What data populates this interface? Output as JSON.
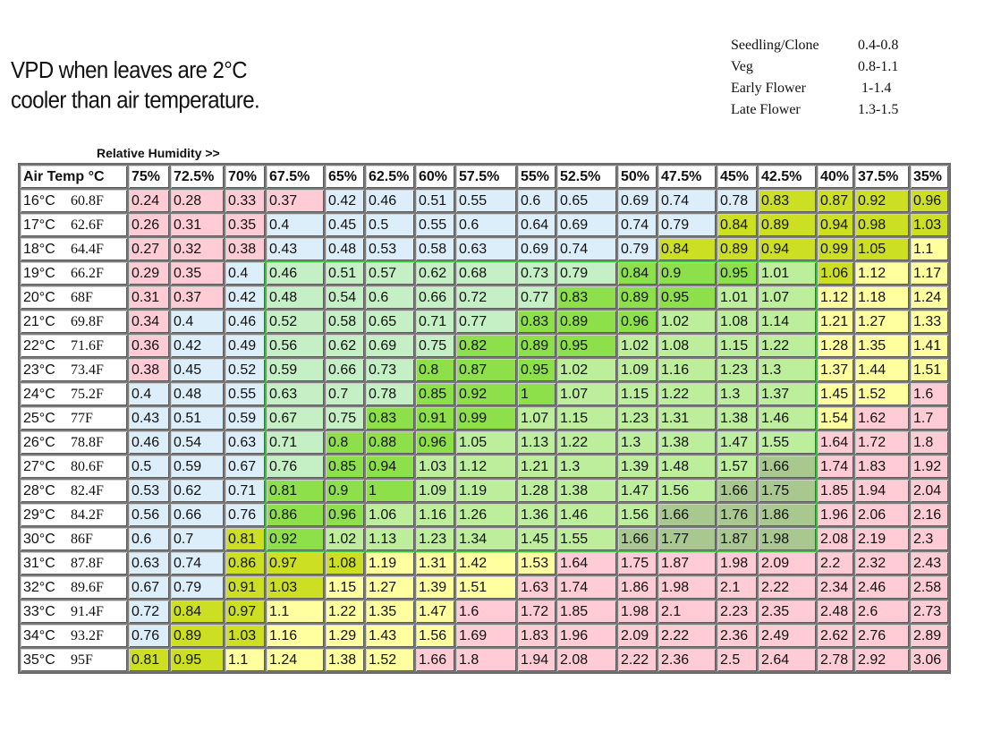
{
  "title_lines": [
    "VPD when leaves are 2°C",
    "cooler than air temperature."
  ],
  "legend": [
    {
      "name": "Seedling/Clone",
      "range": "0.4-0.8"
    },
    {
      "name": "Veg",
      "range": "0.8-1.1"
    },
    {
      "name": "Early Flower",
      "range": "1-1.4"
    },
    {
      "name": "Late Flower",
      "range": "1.3-1.5"
    }
  ],
  "colors": {
    "low": "#ffccd6",
    "seedling": "#ddeefb",
    "veg": "#c5f0c5",
    "veg_strong": "#8ee04a",
    "early_flower": "#bdee9b",
    "late_flower": "#a8c890",
    "caution": "#ffff9f",
    "yellow_green": "#cddf22",
    "high": "#ffccd6",
    "optimal_border": "#35c235"
  },
  "chart_data": {
    "type": "table",
    "title": "VPD when leaves are 2°C cooler than air temperature.",
    "column_group_label": "Relative Humidity >>",
    "corner_label": "Air Temp °C",
    "columns": [
      "75%",
      "72.5%",
      "70%",
      "67.5%",
      "65%",
      "62.5%",
      "60%",
      "57.5%",
      "55%",
      "52.5%",
      "50%",
      "47.5%",
      "45%",
      "42.5%",
      "40%",
      "37.5%",
      "35%"
    ],
    "rows": [
      {
        "c": "16°C",
        "f": "60.8F",
        "values": [
          "0.24",
          "0.28",
          "0.33",
          "0.37",
          "0.42",
          "0.46",
          "0.51",
          "0.55",
          "0.6",
          "0.65",
          "0.69",
          "0.74",
          "0.78",
          "0.83",
          "0.87",
          "0.92",
          "0.96"
        ]
      },
      {
        "c": "17°C",
        "f": "62.6F",
        "values": [
          "0.26",
          "0.31",
          "0.35",
          "0.4",
          "0.45",
          "0.5",
          "0.55",
          "0.6",
          "0.64",
          "0.69",
          "0.74",
          "0.79",
          "0.84",
          "0.89",
          "0.94",
          "0.98",
          "1.03"
        ]
      },
      {
        "c": "18°C",
        "f": "64.4F",
        "values": [
          "0.27",
          "0.32",
          "0.38",
          "0.43",
          "0.48",
          "0.53",
          "0.58",
          "0.63",
          "0.69",
          "0.74",
          "0.79",
          "0.84",
          "0.89",
          "0.94",
          "0.99",
          "1.05",
          "1.1"
        ]
      },
      {
        "c": "19°C",
        "f": "66.2F",
        "values": [
          "0.29",
          "0.35",
          "0.4",
          "0.46",
          "0.51",
          "0.57",
          "0.62",
          "0.68",
          "0.73",
          "0.79",
          "0.84",
          "0.9",
          "0.95",
          "1.01",
          "1.06",
          "1.12",
          "1.17"
        ]
      },
      {
        "c": "20°C",
        "f": "68F",
        "values": [
          "0.31",
          "0.37",
          "0.42",
          "0.48",
          "0.54",
          "0.6",
          "0.66",
          "0.72",
          "0.77",
          "0.83",
          "0.89",
          "0.95",
          "1.01",
          "1.07",
          "1.12",
          "1.18",
          "1.24"
        ]
      },
      {
        "c": "21°C",
        "f": "69.8F",
        "values": [
          "0.34",
          "0.4",
          "0.46",
          "0.52",
          "0.58",
          "0.65",
          "0.71",
          "0.77",
          "0.83",
          "0.89",
          "0.96",
          "1.02",
          "1.08",
          "1.14",
          "1.21",
          "1.27",
          "1.33"
        ]
      },
      {
        "c": "22°C",
        "f": "71.6F",
        "values": [
          "0.36",
          "0.42",
          "0.49",
          "0.56",
          "0.62",
          "0.69",
          "0.75",
          "0.82",
          "0.89",
          "0.95",
          "1.02",
          "1.08",
          "1.15",
          "1.22",
          "1.28",
          "1.35",
          "1.41"
        ]
      },
      {
        "c": "23°C",
        "f": "73.4F",
        "values": [
          "0.38",
          "0.45",
          "0.52",
          "0.59",
          "0.66",
          "0.73",
          "0.8",
          "0.87",
          "0.95",
          "1.02",
          "1.09",
          "1.16",
          "1.23",
          "1.3",
          "1.37",
          "1.44",
          "1.51"
        ]
      },
      {
        "c": "24°C",
        "f": "75.2F",
        "values": [
          "0.4",
          "0.48",
          "0.55",
          "0.63",
          "0.7",
          "0.78",
          "0.85",
          "0.92",
          "1",
          "1.07",
          "1.15",
          "1.22",
          "1.3",
          "1.37",
          "1.45",
          "1.52",
          "1.6"
        ]
      },
      {
        "c": "25°C",
        "f": "77F",
        "values": [
          "0.43",
          "0.51",
          "0.59",
          "0.67",
          "0.75",
          "0.83",
          "0.91",
          "0.99",
          "1.07",
          "1.15",
          "1.23",
          "1.31",
          "1.38",
          "1.46",
          "1.54",
          "1.62",
          "1.7"
        ]
      },
      {
        "c": "26°C",
        "f": "78.8F",
        "values": [
          "0.46",
          "0.54",
          "0.63",
          "0.71",
          "0.8",
          "0.88",
          "0.96",
          "1.05",
          "1.13",
          "1.22",
          "1.3",
          "1.38",
          "1.47",
          "1.55",
          "1.64",
          "1.72",
          "1.8"
        ]
      },
      {
        "c": "27°C",
        "f": "80.6F",
        "values": [
          "0.5",
          "0.59",
          "0.67",
          "0.76",
          "0.85",
          "0.94",
          "1.03",
          "1.12",
          "1.21",
          "1.3",
          "1.39",
          "1.48",
          "1.57",
          "1.66",
          "1.74",
          "1.83",
          "1.92"
        ]
      },
      {
        "c": "28°C",
        "f": "82.4F",
        "values": [
          "0.53",
          "0.62",
          "0.71",
          "0.81",
          "0.9",
          "1",
          "1.09",
          "1.19",
          "1.28",
          "1.38",
          "1.47",
          "1.56",
          "1.66",
          "1.75",
          "1.85",
          "1.94",
          "2.04"
        ]
      },
      {
        "c": "29°C",
        "f": "84.2F",
        "values": [
          "0.56",
          "0.66",
          "0.76",
          "0.86",
          "0.96",
          "1.06",
          "1.16",
          "1.26",
          "1.36",
          "1.46",
          "1.56",
          "1.66",
          "1.76",
          "1.86",
          "1.96",
          "2.06",
          "2.16"
        ]
      },
      {
        "c": "30°C",
        "f": "86F",
        "values": [
          "0.6",
          "0.7",
          "0.81",
          "0.92",
          "1.02",
          "1.13",
          "1.23",
          "1.34",
          "1.45",
          "1.55",
          "1.66",
          "1.77",
          "1.87",
          "1.98",
          "2.08",
          "2.19",
          "2.3"
        ]
      },
      {
        "c": "31°C",
        "f": "87.8F",
        "values": [
          "0.63",
          "0.74",
          "0.86",
          "0.97",
          "1.08",
          "1.19",
          "1.31",
          "1.42",
          "1.53",
          "1.64",
          "1.75",
          "1.87",
          "1.98",
          "2.09",
          "2.2",
          "2.32",
          "2.43"
        ]
      },
      {
        "c": "32°C",
        "f": "89.6F",
        "values": [
          "0.67",
          "0.79",
          "0.91",
          "1.03",
          "1.15",
          "1.27",
          "1.39",
          "1.51",
          "1.63",
          "1.74",
          "1.86",
          "1.98",
          "2.1",
          "2.22",
          "2.34",
          "2.46",
          "2.58"
        ]
      },
      {
        "c": "33°C",
        "f": "91.4F",
        "values": [
          "0.72",
          "0.84",
          "0.97",
          "1.1",
          "1.22",
          "1.35",
          "1.47",
          "1.6",
          "1.72",
          "1.85",
          "1.98",
          "2.1",
          "2.23",
          "2.35",
          "2.48",
          "2.6",
          "2.73"
        ]
      },
      {
        "c": "34°C",
        "f": "93.2F",
        "values": [
          "0.76",
          "0.89",
          "1.03",
          "1.16",
          "1.29",
          "1.43",
          "1.56",
          "1.69",
          "1.83",
          "1.96",
          "2.09",
          "2.22",
          "2.36",
          "2.49",
          "2.62",
          "2.76",
          "2.89"
        ]
      },
      {
        "c": "35°C",
        "f": "95F",
        "values": [
          "0.81",
          "0.95",
          "1.1",
          "1.24",
          "1.38",
          "1.52",
          "1.66",
          "1.8",
          "1.94",
          "2.08",
          "2.22",
          "2.36",
          "2.5",
          "2.64",
          "2.78",
          "2.92",
          "3.06"
        ]
      }
    ],
    "optimal_region": {
      "rows": [
        "19°C",
        "30°C"
      ],
      "columns": [
        "67.5%",
        "42.5%"
      ]
    }
  }
}
